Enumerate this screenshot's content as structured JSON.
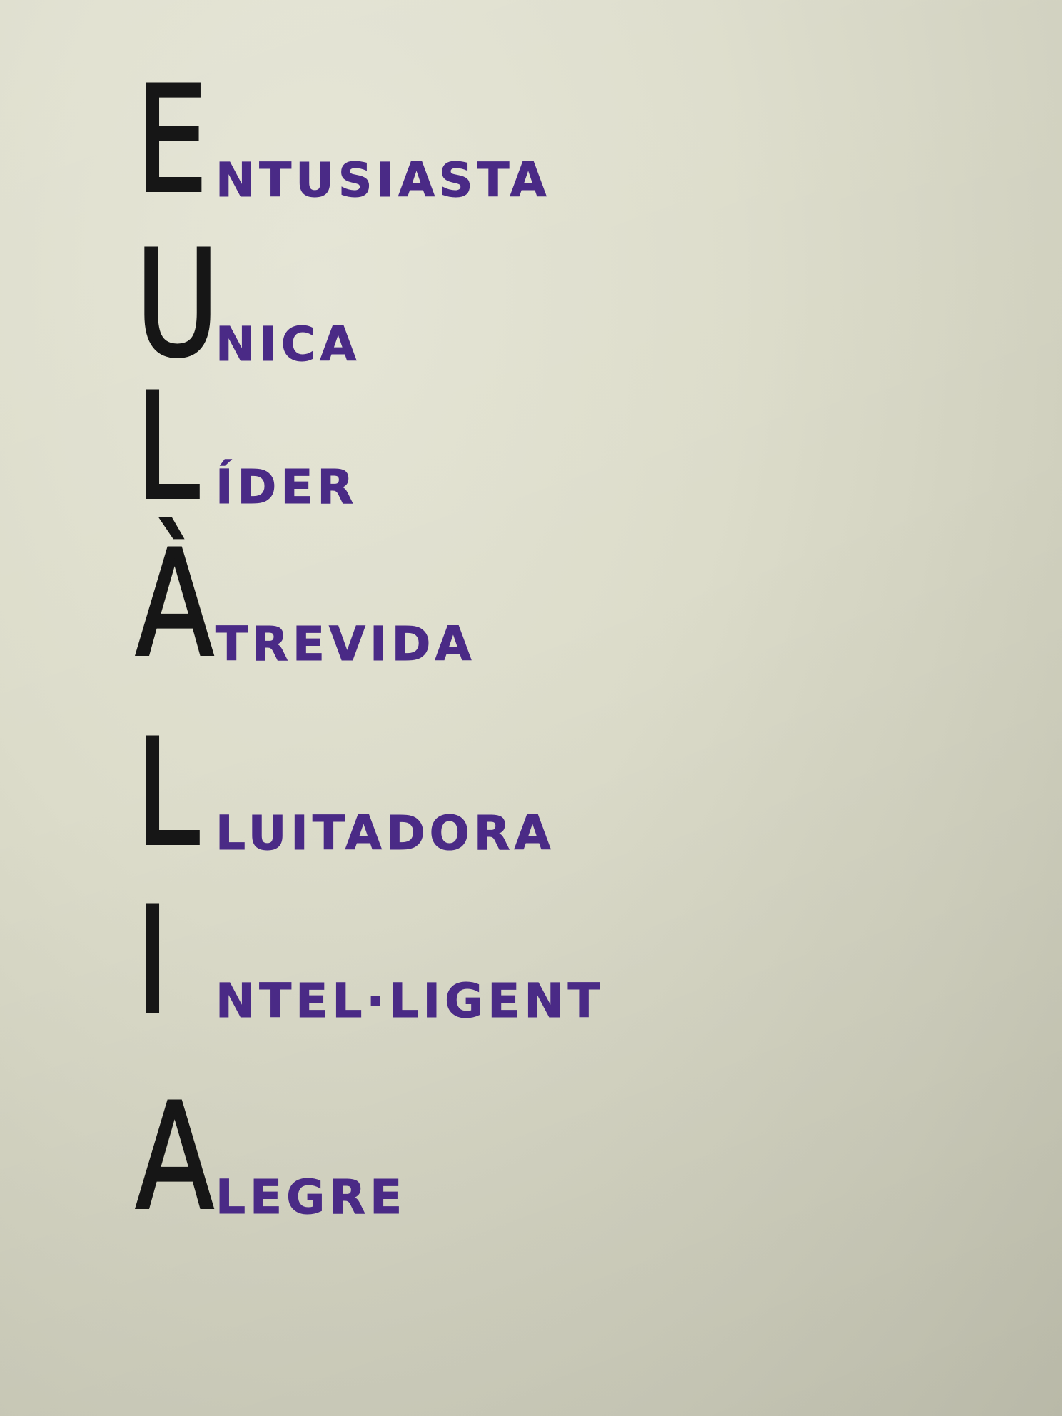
{
  "acrostic": {
    "lines": [
      {
        "initial": "E",
        "rest": "NTUSIASTA"
      },
      {
        "initial": "U",
        "rest": "NICA"
      },
      {
        "initial": "L",
        "rest": "ÍDER"
      },
      {
        "initial": "À",
        "rest": "TREVIDA"
      },
      {
        "initial": "L",
        "rest": "LUITADORA"
      },
      {
        "initial": "I",
        "rest": "NTEL·LIGENT"
      },
      {
        "initial": "A",
        "rest": "LEGRE"
      }
    ]
  },
  "colors": {
    "paper": "#dcdcca",
    "initial_ink": "#161616",
    "word_ink": "#4a2a86"
  }
}
